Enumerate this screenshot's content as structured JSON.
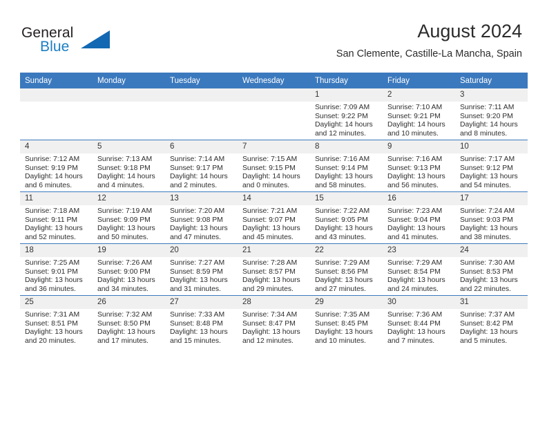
{
  "brand": {
    "name_part1": "General",
    "name_part2": "Blue",
    "logo_icon": "triangle-flag-icon"
  },
  "header": {
    "month_title": "August 2024",
    "location": "San Clemente, Castille-La Mancha, Spain"
  },
  "calendar": {
    "weekday_headers": [
      "Sunday",
      "Monday",
      "Tuesday",
      "Wednesday",
      "Thursday",
      "Friday",
      "Saturday"
    ],
    "colors": {
      "header_blue": "#3b79be",
      "daynum_band": "#f0f0f0",
      "brand_blue": "#1b7ec2",
      "logo_blue": "#1268b3"
    },
    "weeks": [
      [
        {
          "day": "",
          "sunrise": "",
          "sunset": "",
          "daylight_line1": "",
          "daylight_line2": "",
          "empty": true
        },
        {
          "day": "",
          "sunrise": "",
          "sunset": "",
          "daylight_line1": "",
          "daylight_line2": "",
          "empty": true
        },
        {
          "day": "",
          "sunrise": "",
          "sunset": "",
          "daylight_line1": "",
          "daylight_line2": "",
          "empty": true
        },
        {
          "day": "",
          "sunrise": "",
          "sunset": "",
          "daylight_line1": "",
          "daylight_line2": "",
          "empty": true
        },
        {
          "day": "1",
          "sunrise": "Sunrise: 7:09 AM",
          "sunset": "Sunset: 9:22 PM",
          "daylight_line1": "Daylight: 14 hours",
          "daylight_line2": "and 12 minutes."
        },
        {
          "day": "2",
          "sunrise": "Sunrise: 7:10 AM",
          "sunset": "Sunset: 9:21 PM",
          "daylight_line1": "Daylight: 14 hours",
          "daylight_line2": "and 10 minutes."
        },
        {
          "day": "3",
          "sunrise": "Sunrise: 7:11 AM",
          "sunset": "Sunset: 9:20 PM",
          "daylight_line1": "Daylight: 14 hours",
          "daylight_line2": "and 8 minutes."
        }
      ],
      [
        {
          "day": "4",
          "sunrise": "Sunrise: 7:12 AM",
          "sunset": "Sunset: 9:19 PM",
          "daylight_line1": "Daylight: 14 hours",
          "daylight_line2": "and 6 minutes."
        },
        {
          "day": "5",
          "sunrise": "Sunrise: 7:13 AM",
          "sunset": "Sunset: 9:18 PM",
          "daylight_line1": "Daylight: 14 hours",
          "daylight_line2": "and 4 minutes."
        },
        {
          "day": "6",
          "sunrise": "Sunrise: 7:14 AM",
          "sunset": "Sunset: 9:17 PM",
          "daylight_line1": "Daylight: 14 hours",
          "daylight_line2": "and 2 minutes."
        },
        {
          "day": "7",
          "sunrise": "Sunrise: 7:15 AM",
          "sunset": "Sunset: 9:15 PM",
          "daylight_line1": "Daylight: 14 hours",
          "daylight_line2": "and 0 minutes."
        },
        {
          "day": "8",
          "sunrise": "Sunrise: 7:16 AM",
          "sunset": "Sunset: 9:14 PM",
          "daylight_line1": "Daylight: 13 hours",
          "daylight_line2": "and 58 minutes."
        },
        {
          "day": "9",
          "sunrise": "Sunrise: 7:16 AM",
          "sunset": "Sunset: 9:13 PM",
          "daylight_line1": "Daylight: 13 hours",
          "daylight_line2": "and 56 minutes."
        },
        {
          "day": "10",
          "sunrise": "Sunrise: 7:17 AM",
          "sunset": "Sunset: 9:12 PM",
          "daylight_line1": "Daylight: 13 hours",
          "daylight_line2": "and 54 minutes."
        }
      ],
      [
        {
          "day": "11",
          "sunrise": "Sunrise: 7:18 AM",
          "sunset": "Sunset: 9:11 PM",
          "daylight_line1": "Daylight: 13 hours",
          "daylight_line2": "and 52 minutes."
        },
        {
          "day": "12",
          "sunrise": "Sunrise: 7:19 AM",
          "sunset": "Sunset: 9:09 PM",
          "daylight_line1": "Daylight: 13 hours",
          "daylight_line2": "and 50 minutes."
        },
        {
          "day": "13",
          "sunrise": "Sunrise: 7:20 AM",
          "sunset": "Sunset: 9:08 PM",
          "daylight_line1": "Daylight: 13 hours",
          "daylight_line2": "and 47 minutes."
        },
        {
          "day": "14",
          "sunrise": "Sunrise: 7:21 AM",
          "sunset": "Sunset: 9:07 PM",
          "daylight_line1": "Daylight: 13 hours",
          "daylight_line2": "and 45 minutes."
        },
        {
          "day": "15",
          "sunrise": "Sunrise: 7:22 AM",
          "sunset": "Sunset: 9:05 PM",
          "daylight_line1": "Daylight: 13 hours",
          "daylight_line2": "and 43 minutes."
        },
        {
          "day": "16",
          "sunrise": "Sunrise: 7:23 AM",
          "sunset": "Sunset: 9:04 PM",
          "daylight_line1": "Daylight: 13 hours",
          "daylight_line2": "and 41 minutes."
        },
        {
          "day": "17",
          "sunrise": "Sunrise: 7:24 AM",
          "sunset": "Sunset: 9:03 PM",
          "daylight_line1": "Daylight: 13 hours",
          "daylight_line2": "and 38 minutes."
        }
      ],
      [
        {
          "day": "18",
          "sunrise": "Sunrise: 7:25 AM",
          "sunset": "Sunset: 9:01 PM",
          "daylight_line1": "Daylight: 13 hours",
          "daylight_line2": "and 36 minutes."
        },
        {
          "day": "19",
          "sunrise": "Sunrise: 7:26 AM",
          "sunset": "Sunset: 9:00 PM",
          "daylight_line1": "Daylight: 13 hours",
          "daylight_line2": "and 34 minutes."
        },
        {
          "day": "20",
          "sunrise": "Sunrise: 7:27 AM",
          "sunset": "Sunset: 8:59 PM",
          "daylight_line1": "Daylight: 13 hours",
          "daylight_line2": "and 31 minutes."
        },
        {
          "day": "21",
          "sunrise": "Sunrise: 7:28 AM",
          "sunset": "Sunset: 8:57 PM",
          "daylight_line1": "Daylight: 13 hours",
          "daylight_line2": "and 29 minutes."
        },
        {
          "day": "22",
          "sunrise": "Sunrise: 7:29 AM",
          "sunset": "Sunset: 8:56 PM",
          "daylight_line1": "Daylight: 13 hours",
          "daylight_line2": "and 27 minutes."
        },
        {
          "day": "23",
          "sunrise": "Sunrise: 7:29 AM",
          "sunset": "Sunset: 8:54 PM",
          "daylight_line1": "Daylight: 13 hours",
          "daylight_line2": "and 24 minutes."
        },
        {
          "day": "24",
          "sunrise": "Sunrise: 7:30 AM",
          "sunset": "Sunset: 8:53 PM",
          "daylight_line1": "Daylight: 13 hours",
          "daylight_line2": "and 22 minutes."
        }
      ],
      [
        {
          "day": "25",
          "sunrise": "Sunrise: 7:31 AM",
          "sunset": "Sunset: 8:51 PM",
          "daylight_line1": "Daylight: 13 hours",
          "daylight_line2": "and 20 minutes."
        },
        {
          "day": "26",
          "sunrise": "Sunrise: 7:32 AM",
          "sunset": "Sunset: 8:50 PM",
          "daylight_line1": "Daylight: 13 hours",
          "daylight_line2": "and 17 minutes."
        },
        {
          "day": "27",
          "sunrise": "Sunrise: 7:33 AM",
          "sunset": "Sunset: 8:48 PM",
          "daylight_line1": "Daylight: 13 hours",
          "daylight_line2": "and 15 minutes."
        },
        {
          "day": "28",
          "sunrise": "Sunrise: 7:34 AM",
          "sunset": "Sunset: 8:47 PM",
          "daylight_line1": "Daylight: 13 hours",
          "daylight_line2": "and 12 minutes."
        },
        {
          "day": "29",
          "sunrise": "Sunrise: 7:35 AM",
          "sunset": "Sunset: 8:45 PM",
          "daylight_line1": "Daylight: 13 hours",
          "daylight_line2": "and 10 minutes."
        },
        {
          "day": "30",
          "sunrise": "Sunrise: 7:36 AM",
          "sunset": "Sunset: 8:44 PM",
          "daylight_line1": "Daylight: 13 hours",
          "daylight_line2": "and 7 minutes."
        },
        {
          "day": "31",
          "sunrise": "Sunrise: 7:37 AM",
          "sunset": "Sunset: 8:42 PM",
          "daylight_line1": "Daylight: 13 hours",
          "daylight_line2": "and 5 minutes."
        }
      ]
    ]
  }
}
